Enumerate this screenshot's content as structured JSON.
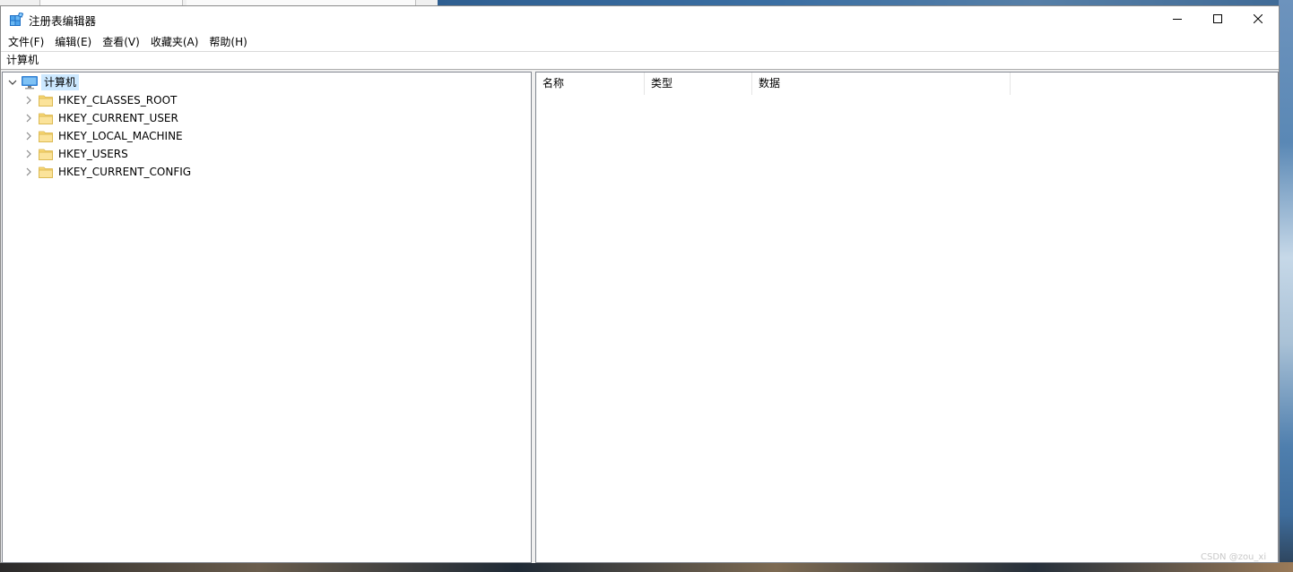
{
  "window": {
    "title": "注册表编辑器",
    "app_icon": "regedit-icon"
  },
  "menubar": {
    "items": [
      {
        "label": "文件(F)"
      },
      {
        "label": "编辑(E)"
      },
      {
        "label": "查看(V)"
      },
      {
        "label": "收藏夹(A)"
      },
      {
        "label": "帮助(H)"
      }
    ]
  },
  "address": {
    "value": "计算机"
  },
  "tree": {
    "root": {
      "label": "计算机",
      "icon": "computer-icon",
      "expanded": true,
      "selected": true
    },
    "children": [
      {
        "label": "HKEY_CLASSES_ROOT",
        "icon": "folder-icon"
      },
      {
        "label": "HKEY_CURRENT_USER",
        "icon": "folder-icon"
      },
      {
        "label": "HKEY_LOCAL_MACHINE",
        "icon": "folder-icon"
      },
      {
        "label": "HKEY_USERS",
        "icon": "folder-icon"
      },
      {
        "label": "HKEY_CURRENT_CONFIG",
        "icon": "folder-icon"
      }
    ]
  },
  "list": {
    "columns": [
      {
        "label": "名称"
      },
      {
        "label": "类型"
      },
      {
        "label": "数据"
      }
    ]
  },
  "watermark": "CSDN @zou_xi",
  "colors": {
    "selection": "#cce8ff",
    "folder": "#f7d774",
    "window_bg": "#f0f0f0"
  }
}
